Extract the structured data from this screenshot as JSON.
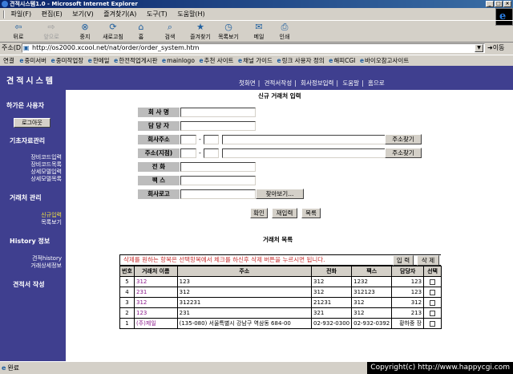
{
  "window": {
    "title": "견적시스템1.0 - Microsoft Internet Explorer",
    "min_glyph": "_",
    "max_glyph": "□",
    "close_glyph": "×"
  },
  "menu": [
    "파일(F)",
    "편집(E)",
    "보기(V)",
    "즐겨찾기(A)",
    "도구(T)",
    "도움말(H)"
  ],
  "toolbar": {
    "back": "뒤로",
    "forward": "앞으로",
    "stop": "중지",
    "refresh": "새로고침",
    "home": "홈",
    "search": "검색",
    "favorites": "즐겨찾기",
    "history": "목록보기",
    "mail": "메일",
    "print": "인쇄"
  },
  "address": {
    "label": "주소(D)",
    "url": "http://os2000.xcool.net/nat/order/order_system.htm",
    "go": "이동"
  },
  "links": {
    "label": "연결",
    "items": [
      "중미서버",
      "중미작업장",
      "한메일",
      "한전적업게시판",
      "mainlogo",
      "추천 사이트",
      "채널 가이드",
      "링크 사용자 정의",
      "해피CGI",
      "바이오참고사이트"
    ]
  },
  "banner": {
    "title": "견적시스템",
    "nav": [
      "첫화면",
      "견적서작성",
      "회사정보입력",
      "도움말",
      "홈으로"
    ],
    "nav_sep": "|"
  },
  "sidebar": {
    "section_admin": "하가은 사용자",
    "logout": "로그아웃",
    "section_basic": "기초자료관리",
    "basic_items": [
      "장비코드입력",
      "장비코드목록",
      "상세모델입력",
      "상세모델목록"
    ],
    "section_client": "거래처 관리",
    "client_items": [
      "신규입력",
      "목록보기"
    ],
    "section_history": "History 정보",
    "history_items": [
      "견적history",
      "거래상세정보"
    ],
    "section_quote": "견적서 작성"
  },
  "form": {
    "title": "신규 거래처 입력",
    "labels": {
      "company": "회 사 명",
      "manager": "담 당 자",
      "addr_company": "회사주소",
      "addr_branch": "주소(지점)",
      "phone": "전    화",
      "fax": "팩    스",
      "logo": "회사로고"
    },
    "dash": "-",
    "find_address": "주소찾기",
    "browse": "찾아보기...",
    "confirm": "확인",
    "reenter": "재입력",
    "list": "목록"
  },
  "client_list": {
    "title": "거래처 목록",
    "notice": "삭제를 원하는 항목은 선택항목에서 체크를 하신후 삭제 버튼을 누르시면 됩니다.",
    "add_button": "입 력",
    "delete_button": "삭 제",
    "columns": [
      "번호",
      "거래처 이름",
      "주소",
      "전화",
      "팩스",
      "담당자",
      "선택"
    ],
    "rows": [
      {
        "no": "5",
        "name": "312",
        "address": "123",
        "phone": "312",
        "fax": "1232",
        "manager": "123"
      },
      {
        "no": "4",
        "name": "231",
        "address": "312",
        "phone": "312",
        "fax": "312123",
        "manager": "123"
      },
      {
        "no": "3",
        "name": "312",
        "address": "312231",
        "phone": "21231",
        "fax": "312",
        "manager": "312"
      },
      {
        "no": "2",
        "name": "123",
        "address": "231",
        "phone": "321",
        "fax": "312",
        "manager": "213"
      },
      {
        "no": "1",
        "name": "(주)제일",
        "address": "(135-080) 서울특별시 강남구 역삼동 684-00",
        "phone": "02-932-0300",
        "fax": "02-932-0392",
        "manager": "황하중 장"
      }
    ]
  },
  "statusbar": {
    "status": "완료",
    "copyright": "Copyright(c) http://www.happycgi.com"
  }
}
